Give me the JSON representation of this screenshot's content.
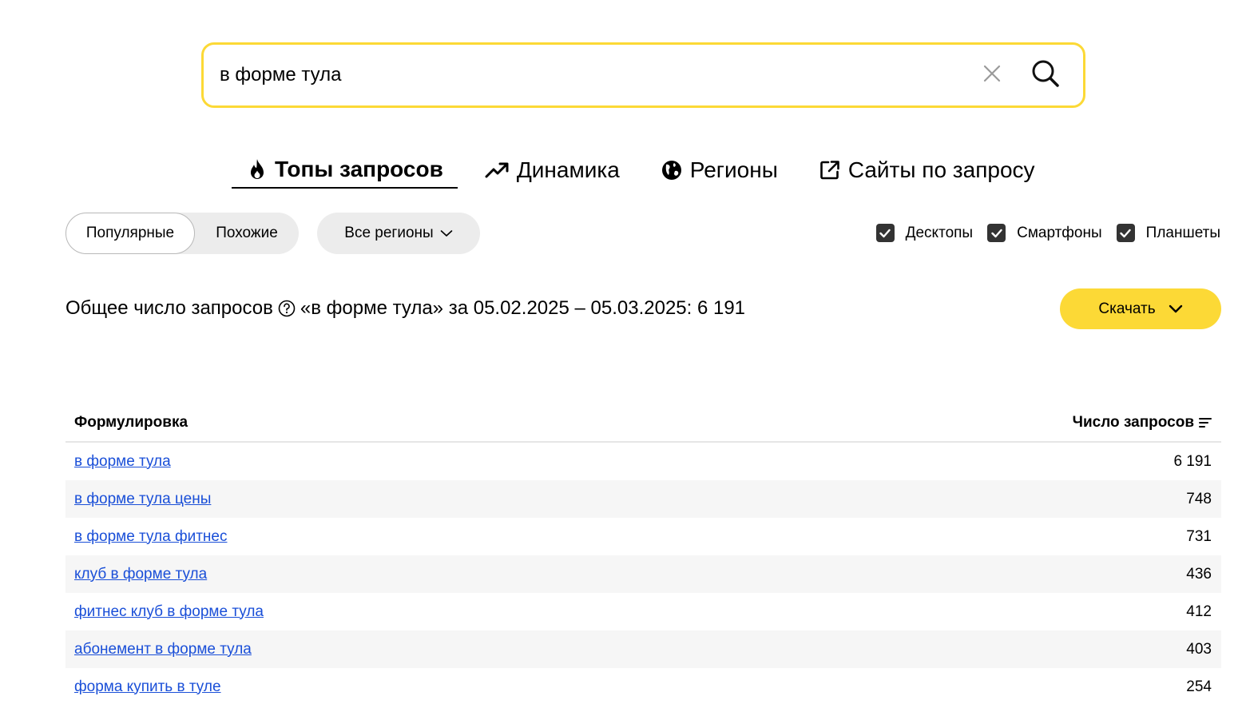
{
  "search": {
    "value": "в форме тула"
  },
  "icons": {
    "clear": "close-icon",
    "search": "search-icon",
    "tops": "fire-icon",
    "dynamics": "trend-up-icon",
    "regions": "globe-icon",
    "sites": "external-link-icon",
    "help": "question-circle-icon",
    "chevron": "chevron-down-icon",
    "sort": "sort-icon",
    "check": "checkbox-checked-icon"
  },
  "tabs": [
    {
      "label": "Топы запросов",
      "active": true
    },
    {
      "label": "Динамика",
      "active": false
    },
    {
      "label": "Регионы",
      "active": false
    },
    {
      "label": "Сайты по запросу",
      "active": false
    }
  ],
  "filters": {
    "popular": "Популярные",
    "similar": "Похожие",
    "region": "Все регионы",
    "devices": [
      {
        "label": "Десктопы",
        "checked": true
      },
      {
        "label": "Смартфоны",
        "checked": true
      },
      {
        "label": "Планшеты",
        "checked": true
      }
    ]
  },
  "summary": {
    "prefix": "Общее число запросов",
    "rest": "«в форме тула» за 05.02.2025 – 05.03.2025: 6 191"
  },
  "download_label": "Скачать",
  "table": {
    "col_phrase": "Формулировка",
    "col_count": "Число запросов",
    "rows": [
      {
        "phrase": "в форме тула",
        "count": "6 191"
      },
      {
        "phrase": "в форме тула цены",
        "count": "748"
      },
      {
        "phrase": "в форме тула фитнес",
        "count": "731"
      },
      {
        "phrase": "клуб в форме тула",
        "count": "436"
      },
      {
        "phrase": "фитнес клуб в форме тула",
        "count": "412"
      },
      {
        "phrase": "абонемент в форме тула",
        "count": "403"
      },
      {
        "phrase": "форма купить в туле",
        "count": "254"
      }
    ]
  },
  "colors": {
    "accent": "#fcd936",
    "link": "#1a4fd8"
  }
}
